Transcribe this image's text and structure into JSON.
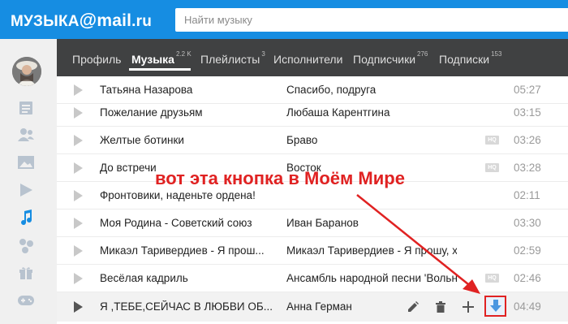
{
  "header": {
    "logo": {
      "part1": "МУЗЫКА",
      "at": "@",
      "part2": "mail",
      "part3": ".ru"
    },
    "search_placeholder": "Найти музыку"
  },
  "nav": {
    "tabs": [
      {
        "label": "Профиль",
        "count": "",
        "active": false
      },
      {
        "label": "Музыка",
        "count": "2.2 K",
        "active": true
      },
      {
        "label": "Плейлисты",
        "count": "3",
        "active": false
      },
      {
        "label": "Исполнители",
        "count": "",
        "active": false
      },
      {
        "label": "Подписчики",
        "count": "276",
        "active": false
      },
      {
        "label": "Подписки",
        "count": "153",
        "active": false
      }
    ]
  },
  "sidebar": {
    "icons": [
      "avatar",
      "feed-icon",
      "friends-icon",
      "photos-icon",
      "video-icon",
      "music-icon",
      "groups-icon",
      "gifts-icon",
      "games-icon"
    ],
    "active_icon": "music-icon",
    "accent": "#168de2"
  },
  "tracks": [
    {
      "title": "Татьяна Назарова",
      "artist": "Спасибо, подруга",
      "duration": "05:27",
      "hq": false
    },
    {
      "title": "Пожелание друзьям",
      "artist": "Любаша Карент­гина",
      "duration": "03:15",
      "hq": false
    },
    {
      "title": "Желтые ботинки",
      "artist": "Браво",
      "duration": "03:26",
      "hq": true
    },
    {
      "title": "До встречи",
      "artist": "Восток",
      "duration": "03:28",
      "hq": true
    },
    {
      "title": "Фронтовики, наденьте ордена!",
      "artist": "",
      "duration": "02:11",
      "hq": false
    },
    {
      "title": "Моя Родина - Советский союз",
      "artist": "Иван Баранов",
      "duration": "03:30",
      "hq": false
    },
    {
      "title": "Микаэл Таривердиев - Я прош...",
      "artist": "Микаэл Таривердиев - Я прошу, хо...",
      "duration": "02:59",
      "hq": false
    },
    {
      "title": "Весёлая кадриль",
      "artist": "Ансамбль народной песни 'Вольн...",
      "duration": "02:46",
      "hq": true
    },
    {
      "title": "Я ,ТЕБЕ,СЕЙЧАС В ЛЮБВИ ОБ...",
      "artist": "Анна Герман",
      "duration": "04:49",
      "hq": false,
      "hovered": true
    }
  ],
  "row_actions": {
    "icons": [
      "edit-icon",
      "delete-icon",
      "add-icon",
      "download-icon"
    ]
  },
  "annotation": {
    "text": "вот эта кнопка в Моём Мире",
    "color": "#e02222"
  },
  "hq_badge": "HQ"
}
